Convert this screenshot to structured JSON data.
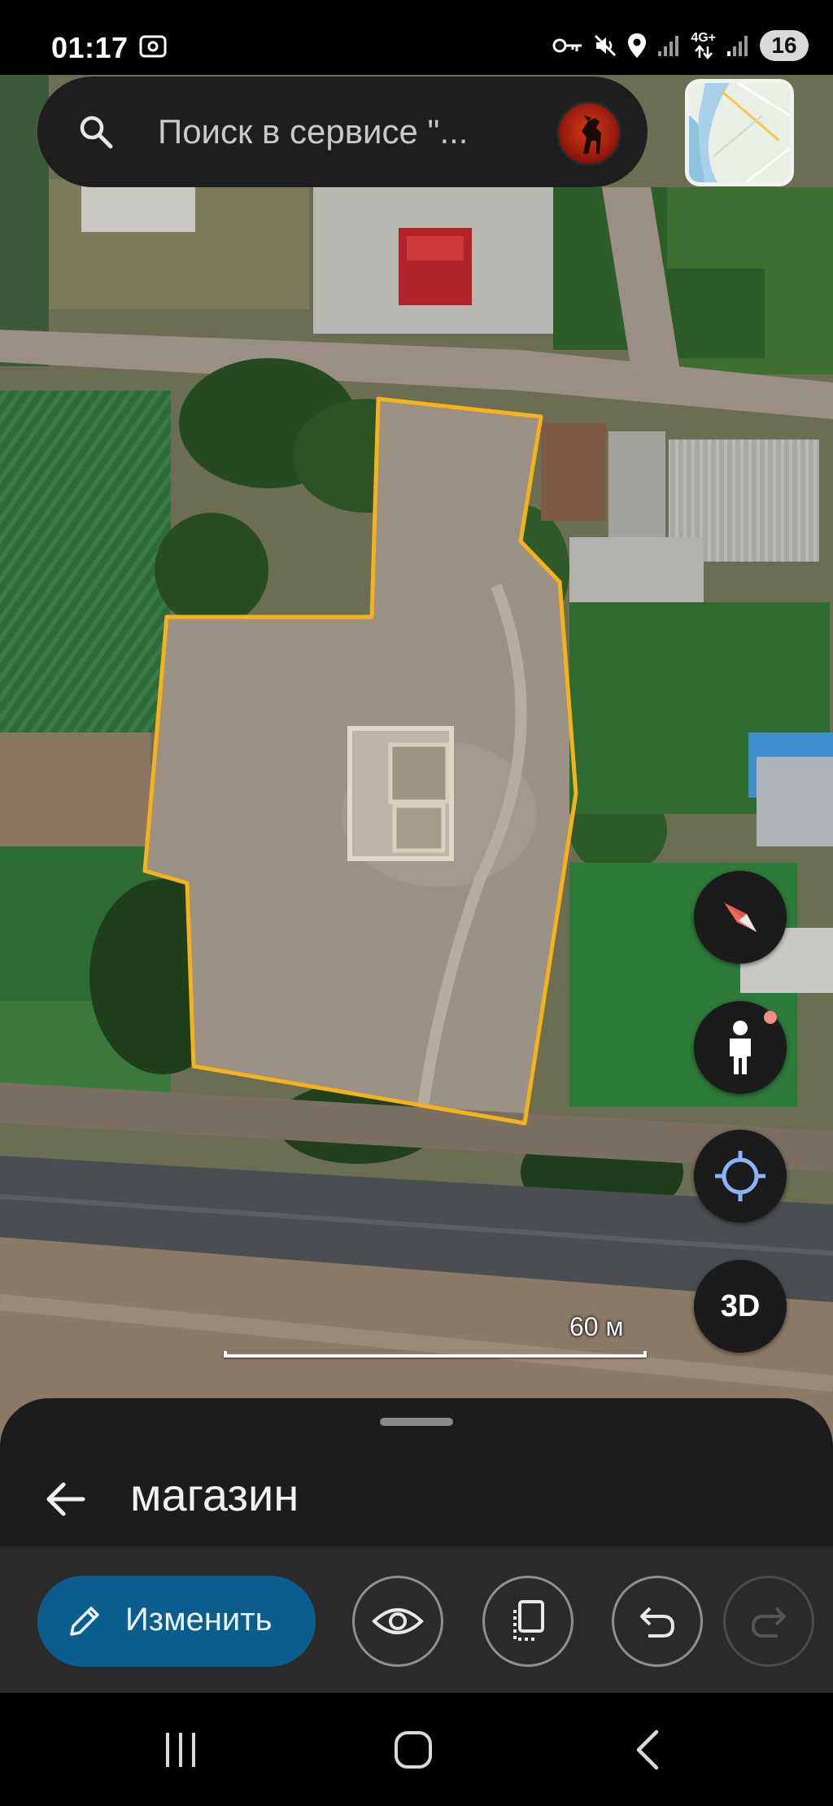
{
  "status_bar": {
    "time": "01:17",
    "network_label": "4G+",
    "battery": "16"
  },
  "search": {
    "placeholder": "Поиск в сервисе \"..."
  },
  "map": {
    "scale_label": "60 м",
    "outline_color": "#f5b21a",
    "controls": {
      "compass_icon": "compass-icon",
      "street_view_icon": "pegman-icon",
      "location_icon": "my-location-icon",
      "three_d_label": "3D"
    }
  },
  "sheet": {
    "title": "магазин",
    "edit_label": "Изменить",
    "accent_color": "#0b5d8d",
    "actions": [
      "eye-icon",
      "copy-icon",
      "undo-icon",
      "redo-icon"
    ]
  },
  "nav": {
    "items": [
      "recents-icon",
      "home-icon",
      "back-icon"
    ]
  }
}
